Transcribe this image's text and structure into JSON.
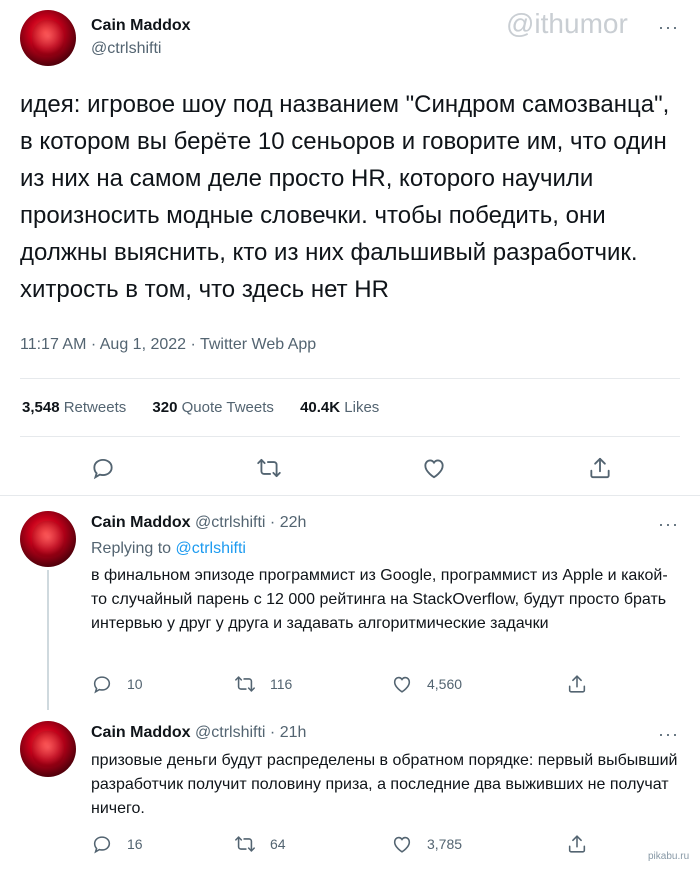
{
  "watermark": "@ithumor",
  "tweet": {
    "author_name": "Cain Maddox",
    "author_handle": "@ctrlshifti",
    "text": "идея: игровое шоу под названием \"Синдром самозванца\", в котором вы берёте 10 сеньоров и говорите им, что один из них на самом деле просто HR, которого научили произносить модные словечки. чтобы победить, они должны выяснить, кто из них фальшивый разработчик. хитрость в том, что здесь нет HR",
    "timestamp": "11:17 AM · Aug 1, 2022 · Twitter Web App",
    "retweets": "3,548",
    "retweets_label": "Retweets",
    "quotes": "320",
    "quotes_label": "Quote Tweets",
    "likes": "40.4K",
    "likes_label": "Likes"
  },
  "replies": [
    {
      "name": "Cain Maddox",
      "handle": "@ctrlshifti · 22h",
      "replying_prefix": "Replying to",
      "replying_to": "@ctrlshifti",
      "text": "в финальном эпизоде программист из Google, программист из Apple и какой-то случайный парень с 12 000 рейтинга на StackOverflow, будут просто брать интервью у друг у друга и задавать алгоритмические задачки",
      "reply_count": "10",
      "retweet_count": "116",
      "like_count": "4,560"
    },
    {
      "name": "Cain Maddox",
      "handle": "@ctrlshifti · 21h",
      "text": "призовые деньги будут распределены в обратном порядке: первый выбывший разработчик получит половину приза, а последние два выживших не получат ничего.",
      "reply_count": "16",
      "retweet_count": "64",
      "like_count": "3,785"
    }
  ],
  "source_label": "pikabu.ru",
  "more_label": "···",
  "icons": {
    "reply": "reply-icon",
    "retweet": "retweet-icon",
    "like": "heart-icon",
    "share": "share-icon",
    "more": "more-icon"
  },
  "colors": {
    "link": "#1d9bf0",
    "secondary_text": "#536471",
    "primary_text": "#0f1419"
  }
}
